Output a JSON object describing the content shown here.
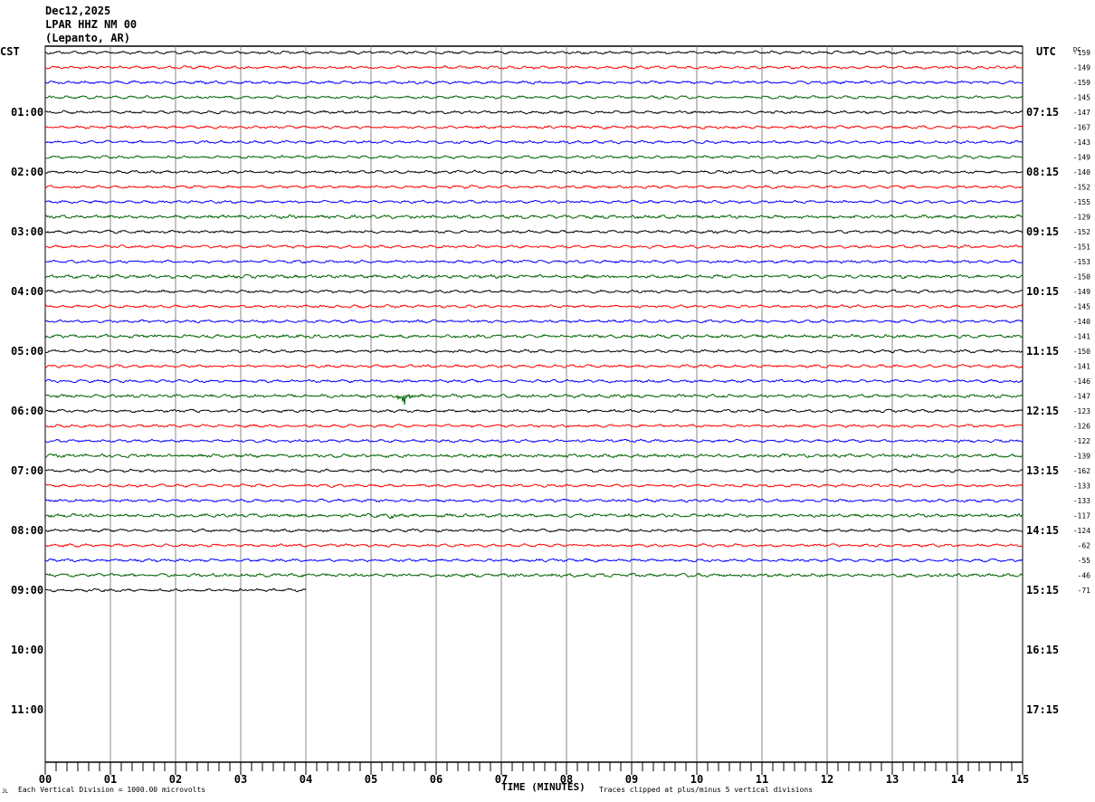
{
  "header": {
    "date": "Dec12,2025",
    "station": "LPAR HHZ NM 00",
    "location": "(Lepanto, AR)"
  },
  "chart_data": {
    "type": "line",
    "subtype": "helicorder",
    "left_axis_title": "CST",
    "right_axis_title": "UTC",
    "dc_title": "DC",
    "xlabel": "TIME (MINUTES)",
    "xlim": [
      0,
      15
    ],
    "x_ticks": [
      "00",
      "01",
      "02",
      "03",
      "04",
      "05",
      "06",
      "07",
      "08",
      "09",
      "10",
      "11",
      "12",
      "13",
      "14",
      "15"
    ],
    "left_hour_labels": [
      {
        "row": 4,
        "label": "01:00"
      },
      {
        "row": 8,
        "label": "02:00"
      },
      {
        "row": 12,
        "label": "03:00"
      },
      {
        "row": 16,
        "label": "04:00"
      },
      {
        "row": 20,
        "label": "05:00"
      },
      {
        "row": 24,
        "label": "06:00"
      },
      {
        "row": 28,
        "label": "07:00"
      },
      {
        "row": 32,
        "label": "08:00"
      },
      {
        "row": 36,
        "label": "09:00"
      },
      {
        "row": 40,
        "label": "10:00"
      },
      {
        "row": 44,
        "label": "11:00"
      }
    ],
    "right_hour_labels": [
      {
        "row": 4,
        "label": "07:15"
      },
      {
        "row": 8,
        "label": "08:15"
      },
      {
        "row": 12,
        "label": "09:15"
      },
      {
        "row": 16,
        "label": "10:15"
      },
      {
        "row": 20,
        "label": "11:15"
      },
      {
        "row": 24,
        "label": "12:15"
      },
      {
        "row": 28,
        "label": "13:15"
      },
      {
        "row": 32,
        "label": "14:15"
      },
      {
        "row": 36,
        "label": "15:15"
      },
      {
        "row": 40,
        "label": "16:15"
      },
      {
        "row": 44,
        "label": "17:15"
      }
    ],
    "total_rows": 48,
    "trace_colors": [
      "#000000",
      "#ff0000",
      "#0000ff",
      "#006400"
    ],
    "dc_offsets": [
      "-159",
      "-149",
      "-159",
      "-145",
      "-147",
      "-167",
      "-143",
      "-149",
      "-140",
      "-152",
      "-155",
      "-129",
      "-152",
      "-151",
      "-153",
      "-150",
      "-149",
      "-145",
      "-140",
      "-141",
      "-150",
      "-141",
      "-146",
      "-147",
      "-123",
      "-126",
      "-122",
      "-139",
      "-162",
      "-133",
      "-133",
      "-117",
      "-124",
      "-62",
      "-55",
      "-46",
      "-71"
    ],
    "last_row_minutes": 4,
    "events": [
      {
        "row": 23,
        "minute": 5.5,
        "amplitude": "large"
      },
      {
        "row": 31,
        "minute": 5.35,
        "amplitude": "small"
      }
    ]
  },
  "footer": {
    "scale_note": "Each Vertical Division = 1000.00 microvolts",
    "clip_note": "Traces clipped at plus/minus 5 vertical divisions",
    "corner_mark": "JL"
  }
}
